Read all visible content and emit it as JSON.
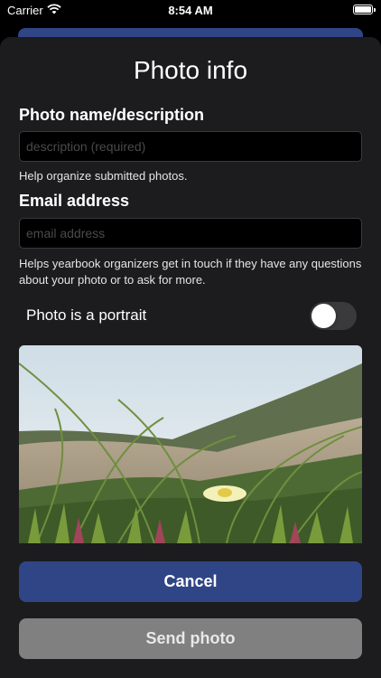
{
  "status_bar": {
    "carrier": "Carrier",
    "time": "8:54 AM"
  },
  "sheet": {
    "title": "Photo info",
    "name_field": {
      "label": "Photo name/description",
      "value": "",
      "placeholder": "description (required)",
      "help": "Help organize submitted photos."
    },
    "email_field": {
      "label": "Email address",
      "value": "",
      "placeholder": "email address",
      "help": "Helps yearbook organizers get in touch if they have any questions about your photo or to ask for more."
    },
    "portrait_toggle": {
      "label": "Photo is a portrait",
      "on": false
    },
    "buttons": {
      "cancel": "Cancel",
      "send": "Send photo"
    }
  },
  "colors": {
    "accent": "#2f4585",
    "sheet_bg": "#1c1c1e",
    "send_disabled": "#808080"
  },
  "icons": [
    "wifi-icon",
    "battery-icon"
  ]
}
